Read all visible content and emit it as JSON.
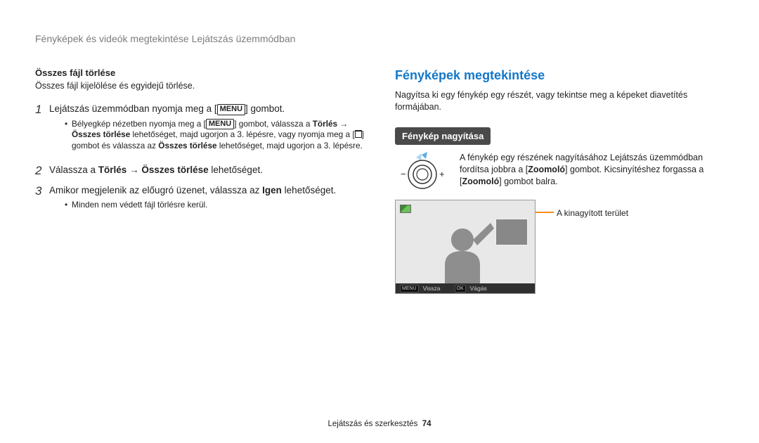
{
  "breadcrumb": "Fényképek és videók megtekintése Lejátszás üzemmódban",
  "left": {
    "sub_title": "Összes fájl törlése",
    "sub_desc": "Összes fájl kijelölése és egyidejű törlése.",
    "menu_label": "MENU",
    "steps": {
      "s1_a": "Lejátszás üzemmódban nyomja meg a [",
      "s1_b": "] gombot.",
      "s1_bullets": {
        "b1a": "Bélyegkép nézetben nyomja meg a [",
        "b1b": "] gombot, válassza a ",
        "b1c": "Törlés",
        "b1d": " → ",
        "b1e": "Összes törlése",
        "b1f": " lehetőséget, majd ugorjon a 3. lépésre, vagy nyomja meg a [",
        "b1g": "] gombot és válassza az ",
        "b1h": "Összes törlése",
        "b1i": " lehetőséget, majd ugorjon a 3. lépésre."
      },
      "s2_a": "Válassza a ",
      "s2_b": "Törlés",
      "s2_c": " → ",
      "s2_d": "Összes törlése",
      "s2_e": " lehetőséget.",
      "s3_a": "Amikor megjelenik az előugró üzenet, válassza az ",
      "s3_b": "Igen",
      "s3_c": " lehetőséget.",
      "s3_bullet": "Minden nem védett fájl törlésre kerül."
    }
  },
  "right": {
    "h2": "Fényképek megtekintése",
    "intro": "Nagyítsa ki egy fénykép egy részét, vagy tekintse meg a képeket diavetítés formájában.",
    "callout": "Fénykép nagyítása",
    "zoom_a": "A fénykép egy részének nagyításához Lejátszás üzemmódban fordítsa jobbra a [",
    "zoom_b": "Zoomoló",
    "zoom_c": "] gombot. Kicsinyítéshez forgassa a [",
    "zoom_d": "Zoomoló",
    "zoom_e": "] gombot balra.",
    "crop_label": "A kinagyított terület",
    "screen": {
      "menu_btn": "MENU",
      "back": "Vissza",
      "ok_btn": "OK",
      "cut": "Vágás"
    },
    "minus": "−",
    "plus": "+"
  },
  "footer": {
    "section": "Lejátszás és szerkesztés",
    "page": "74"
  }
}
